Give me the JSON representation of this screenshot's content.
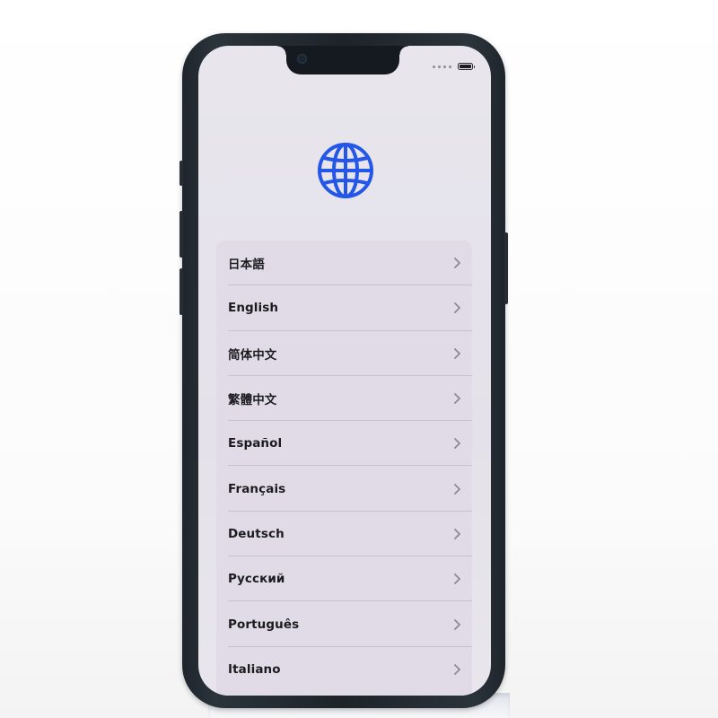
{
  "status_bar": {
    "signal_icon": "signal-dots-icon",
    "battery_icon": "battery-full-icon"
  },
  "header": {
    "icon": "globe-icon",
    "icon_color": "#2457e8"
  },
  "languages": [
    {
      "label": "日本語"
    },
    {
      "label": "English"
    },
    {
      "label": "简体中文"
    },
    {
      "label": "繁體中文"
    },
    {
      "label": "Español"
    },
    {
      "label": "Français"
    },
    {
      "label": "Deutsch"
    },
    {
      "label": "Русский"
    },
    {
      "label": "Português"
    },
    {
      "label": "Italiano"
    }
  ],
  "colors": {
    "screen_background": "#e7e4ec",
    "list_background": "#dfdae6",
    "chevron": "#8e8a94",
    "text": "#1c1c1f"
  }
}
